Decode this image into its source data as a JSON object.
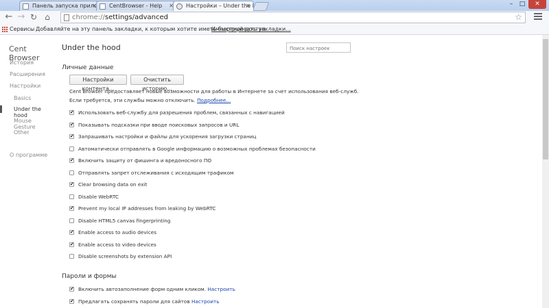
{
  "tabs": [
    {
      "title": "Панель запуска прилож"
    },
    {
      "title": "CentBrowser - Help"
    },
    {
      "title": "Настройки – Under the h"
    }
  ],
  "address": {
    "scheme": "chrome://",
    "path": "settings/advanced"
  },
  "bookmarks_bar": {
    "apps_label": "Сервисы",
    "hint": "Добавляйте на эту панель закладки, к которым хотите иметь быстрый доступ.",
    "import_link": "Импортировать закладки..."
  },
  "sidebar": {
    "brand": "Cent Browser",
    "items": [
      "История",
      "Расширения",
      "Настройки",
      "Basics",
      "Under the hood",
      "Mouse Gesture",
      "Other",
      "О программе"
    ]
  },
  "main": {
    "title": "Under the hood",
    "search_placeholder": "Поиск настроек",
    "privacy": {
      "heading": "Личные данные",
      "content_settings_btn": "Настройки контента...",
      "clear_history_btn": "Очистить историю...",
      "desc_line1": "Cent Browser предоставляет новые возможности для работы в Интернете за счет использования веб-служб.",
      "desc_line2": "Если требуется, эти службы можно отключить.",
      "more_link": "Подробнее..."
    },
    "options": [
      {
        "label": "Использовать веб-службу для разрешения проблем, связанных с навигацией",
        "checked": true
      },
      {
        "label": "Показывать подсказки при вводе поисковых запросов и URL",
        "checked": true
      },
      {
        "label": "Запрашивать настройки и файлы для ускорения загрузки страниц",
        "checked": true
      },
      {
        "label": "Автоматически отправлять в Google информацию о возможных проблемах безопасности",
        "checked": false
      },
      {
        "label": "Включить защиту от фишинга и вредоносного ПО",
        "checked": true
      },
      {
        "label": "Отправлять запрет отслеживания с исходящим трафиком",
        "checked": false
      },
      {
        "label": "Clear browsing data on exit",
        "checked": true
      },
      {
        "label": "Disable WebRTC",
        "checked": false
      },
      {
        "label": "Prevent my local IP addresses from leaking by WebRTC",
        "checked": true
      },
      {
        "label": "Disable HTML5 canvas fingerprinting",
        "checked": false
      },
      {
        "label": "Enable access to audio devices",
        "checked": true
      },
      {
        "label": "Enable access to video devices",
        "checked": true
      },
      {
        "label": "Disable screenshots by extension API",
        "checked": false
      }
    ],
    "passwords": {
      "heading": "Пароли и формы",
      "autofill_label": "Включить автозаполнение форм одним кликом.",
      "autofill_link": "Настроить",
      "autofill_checked": true,
      "save_pw_label": "Предлагать сохранять пароли для сайтов",
      "save_pw_link": "Настроить",
      "save_pw_checked": true
    }
  }
}
